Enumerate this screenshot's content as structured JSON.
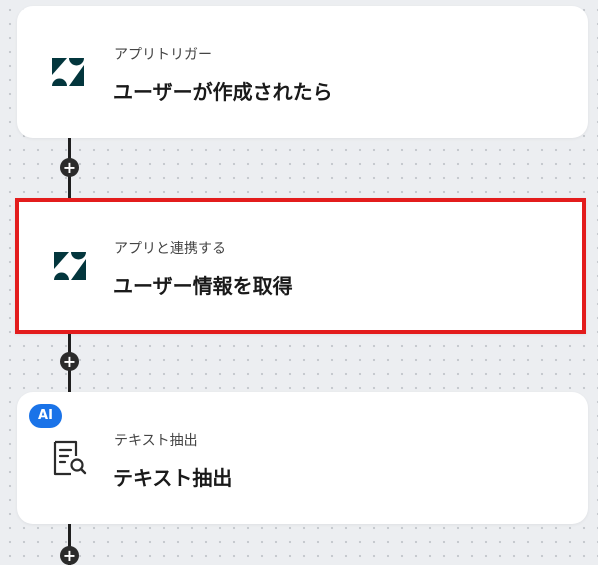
{
  "flow": {
    "steps": [
      {
        "subtitle": "アプリトリガー",
        "title": "ユーザーが作成されたら",
        "icon": "zendesk-logo-icon",
        "selected": false
      },
      {
        "subtitle": "アプリと連携する",
        "title": "ユーザー情報を取得",
        "icon": "zendesk-logo-icon",
        "selected": true
      },
      {
        "subtitle": "テキスト抽出",
        "title": "テキスト抽出",
        "icon": "document-search-icon",
        "badge": "AI",
        "selected": false
      }
    ],
    "add_step_symbol": "+"
  },
  "colors": {
    "zendesk_brand": "#03363d",
    "selection_border": "#e31c1c",
    "ai_badge": "#1a73e8",
    "connector": "#1f1f1f"
  }
}
